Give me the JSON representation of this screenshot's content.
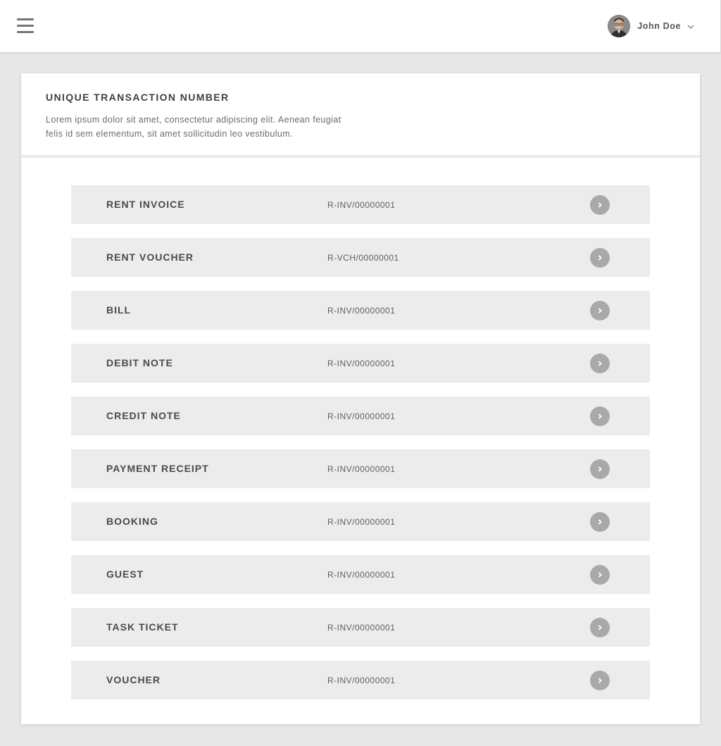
{
  "header": {
    "menu_icon": "hamburger-menu-icon",
    "user": {
      "name": "John Doe",
      "avatar_icon": "user-avatar",
      "dropdown_icon": "chevron-down-icon"
    }
  },
  "card": {
    "title": "UNIQUE TRANSACTION NUMBER",
    "description": "Lorem ipsum dolor sit amet, consectetur adipiscing elit. Aenean feugiat felis id sem elementum, sit amet sollicitudin leo vestibulum."
  },
  "rows": [
    {
      "label": "RENT INVOICE",
      "code": "R-INV/00000001"
    },
    {
      "label": "RENT VOUCHER",
      "code": "R-VCH/00000001"
    },
    {
      "label": "BILL",
      "code": "R-INV/00000001"
    },
    {
      "label": "DEBIT NOTE",
      "code": "R-INV/00000001"
    },
    {
      "label": "CREDIT NOTE",
      "code": "R-INV/00000001"
    },
    {
      "label": "PAYMENT RECEIPT",
      "code": "R-INV/00000001"
    },
    {
      "label": "BOOKING",
      "code": "R-INV/00000001"
    },
    {
      "label": "GUEST",
      "code": "R-INV/00000001"
    },
    {
      "label": "TASK TICKET",
      "code": "R-INV/00000001"
    },
    {
      "label": "VOUCHER",
      "code": "R-INV/00000001"
    }
  ],
  "colors": {
    "background": "#e7e7e7",
    "card": "#ffffff",
    "row": "#ececec",
    "row_button": "#a9a9a9"
  }
}
